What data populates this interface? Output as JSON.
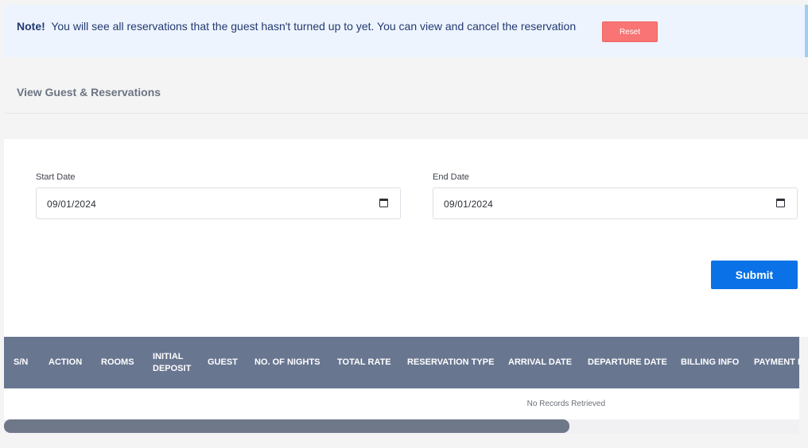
{
  "note": {
    "label": "Note!",
    "message": "You will see all reservations that the guest hasn't turned up to yet. You can view and cancel the reservation",
    "reset_label": "Reset"
  },
  "section": {
    "title": "View Guest & Reservations"
  },
  "form": {
    "start_date": {
      "label": "Start Date",
      "value": "09/01/2024"
    },
    "end_date": {
      "label": "End Date",
      "value": "09/01/2024"
    },
    "submit_label": "Submit"
  },
  "table": {
    "columns": [
      "S/N",
      "ACTION",
      "ROOMS",
      "INITIAL DEPOSIT",
      "GUEST",
      "NO. OF NIGHTS",
      "TOTAL RATE",
      "RESERVATION TYPE",
      "ARRIVAL DATE",
      "DEPARTURE DATE",
      "BILLING INFO",
      "PAYMENT METHOD"
    ],
    "empty_message": "No Records Retrieved",
    "scroll_position": 0
  },
  "colors": {
    "note_bg": "#edf4fd",
    "note_text": "#233a72",
    "reset_bg": "#f97474",
    "submit_bg": "#0a72e6",
    "table_header_bg": "#687690"
  },
  "icons": {
    "calendar": "calendar-icon"
  }
}
